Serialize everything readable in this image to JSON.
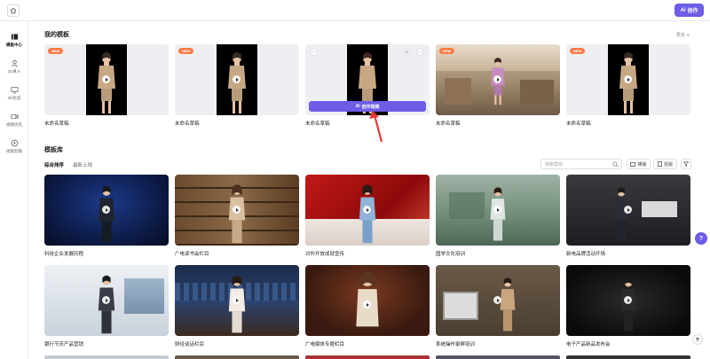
{
  "topbar": {
    "create_label": "创作",
    "create_prefix": "Ai"
  },
  "sidebar": {
    "items": [
      {
        "label": "模板中心",
        "icon": "template-icon",
        "active": true
      },
      {
        "label": "2D真人",
        "icon": "person-icon",
        "active": false
      },
      {
        "label": "3D生成",
        "icon": "monitor-icon",
        "active": false
      },
      {
        "label": "视频优先",
        "icon": "video-icon",
        "active": false
      },
      {
        "label": "视频剪辑",
        "icon": "clip-icon",
        "active": false
      }
    ]
  },
  "my_templates": {
    "title": "我的模板",
    "more_label": "更多",
    "cards": [
      {
        "caption": "未命名草稿",
        "badge": "NEW"
      },
      {
        "caption": "未命名草稿",
        "badge": "NEW"
      },
      {
        "caption": "未命名草稿",
        "badge": "",
        "hover_button": "创作视频"
      },
      {
        "caption": "未命名草稿",
        "badge": "NEW"
      },
      {
        "caption": "未命名草稿",
        "badge": "NEW"
      }
    ],
    "hover_prefix": "Ai"
  },
  "library": {
    "title": "模板库",
    "tabs": [
      "综合排序",
      "最新上线"
    ],
    "search_placeholder": "搜索案例",
    "filter_landscape": "横版",
    "filter_portrait": "竖版",
    "row1": [
      {
        "caption": "科技企业发展历程"
      },
      {
        "caption": "广电读书会栏目"
      },
      {
        "caption": "对外开放成就宣传"
      },
      {
        "caption": "国学文化培训"
      },
      {
        "caption": "新电品牌活动开场"
      }
    ],
    "row2": [
      {
        "caption": "银行节庆产品营销"
      },
      {
        "caption": "财经谈话栏目"
      },
      {
        "caption": "广电媒体专题栏目"
      },
      {
        "caption": "系统操作录屏培训"
      },
      {
        "caption": "电子产品新品发布会"
      }
    ]
  },
  "help_label": "?",
  "colors": {
    "accent": "#6c5ce7",
    "new_badge": "#ff7a45",
    "arrow": "#e53935"
  }
}
